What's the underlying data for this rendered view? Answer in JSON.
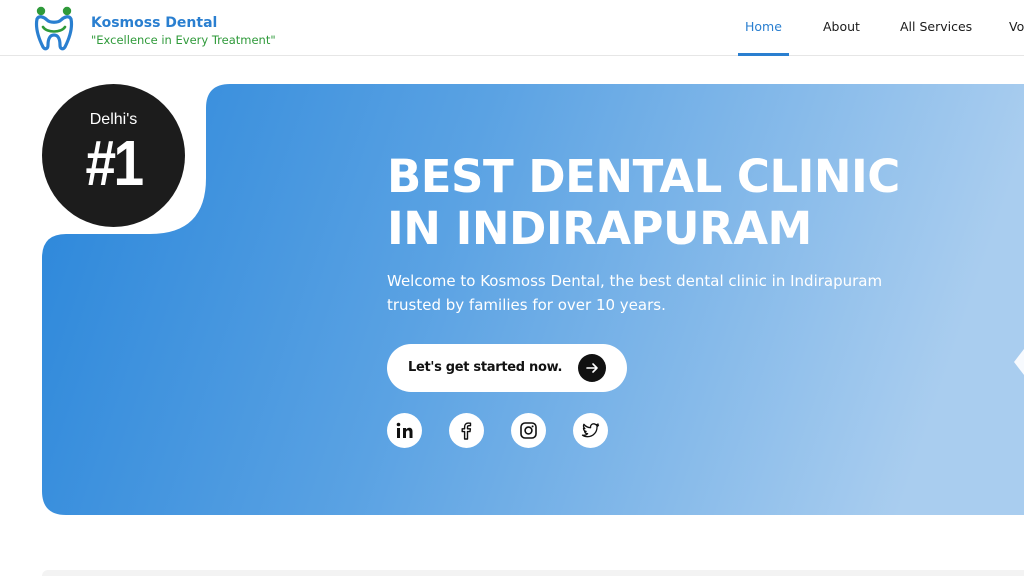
{
  "brand": {
    "name": "Kosmoss Dental",
    "tagline": "\"Excellence in Every Treatment\"",
    "logo_icon": "tooth-family-logo-icon"
  },
  "nav": {
    "items": [
      {
        "label": "Home",
        "active": true
      },
      {
        "label": "About",
        "active": false
      },
      {
        "label": "All Services",
        "active": false
      },
      {
        "label": "Vo",
        "active": false
      }
    ]
  },
  "hero": {
    "badge_small": "Delhi's",
    "badge_big": "#1",
    "title_line1": "BEST DENTAL CLINIC",
    "title_line2": "IN INDIRAPURAM",
    "subtitle_line1": "Welcome to Kosmoss Dental, the best dental clinic in Indirapuram",
    "subtitle_line2": "trusted by families for over 10 years.",
    "cta_label": "Let's get started now.",
    "cta_icon": "arrow-right-icon"
  },
  "social": [
    {
      "name": "linkedin-icon"
    },
    {
      "name": "facebook-icon"
    },
    {
      "name": "instagram-icon"
    },
    {
      "name": "twitter-icon"
    }
  ],
  "colors": {
    "accent": "#2a7fd0",
    "tagline": "#2f9a3a",
    "hero_gradient_start": "#2a86da",
    "hero_gradient_end": "#a9cdef",
    "badge": "#1c1c1c"
  }
}
